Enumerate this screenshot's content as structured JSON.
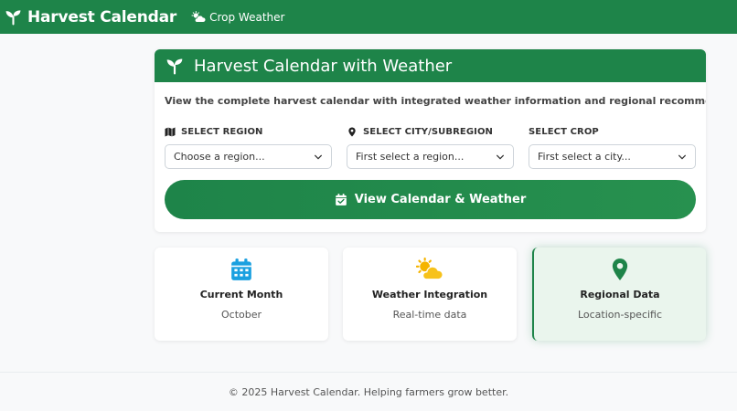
{
  "navbar": {
    "brand": "Harvest Calendar",
    "brand_icon": "seedling-icon",
    "links": [
      {
        "label": "Crop Weather",
        "icon": "cloud-sun-icon"
      }
    ]
  },
  "main_card": {
    "title": "Harvest Calendar with Weather",
    "description": "View the complete harvest calendar with integrated weather information and regional recommendations.",
    "selects": [
      {
        "label": "SELECT REGION",
        "icon": "map-icon",
        "value": "Choose a region..."
      },
      {
        "label": "SELECT CITY/SUBREGION",
        "icon": "map-pin-icon",
        "value": "First select a region..."
      },
      {
        "label": "SELECT CROP",
        "icon": "",
        "value": "First select a city..."
      }
    ],
    "button_label": "View Calendar & Weather"
  },
  "features": [
    {
      "title": "Current Month",
      "subtitle": "October",
      "icon": "calendar-icon"
    },
    {
      "title": "Weather Integration",
      "subtitle": "Real-time data",
      "icon": "sun-cloud-icon"
    },
    {
      "title": "Regional Data",
      "subtitle": "Location-specific",
      "icon": "location-pin-icon"
    }
  ],
  "footer": {
    "text": "© 2025 Harvest Calendar. Helping farmers grow better."
  },
  "colors": {
    "primary_green": "#1e8449",
    "calendar_blue": "#1aa0e0",
    "weather_yellow": "#f5b400",
    "feature_highlight_bg": "#eaf5ed"
  }
}
